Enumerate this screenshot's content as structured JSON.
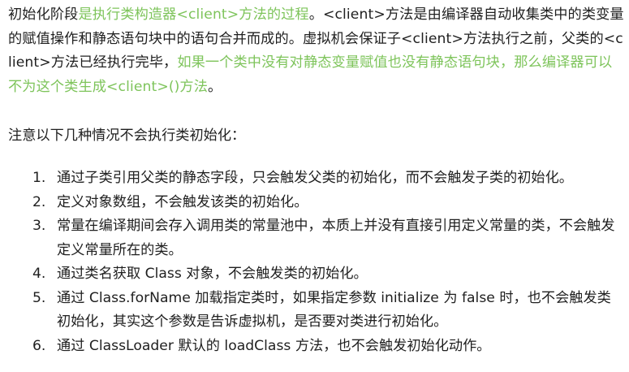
{
  "paragraph": {
    "p1": "初始化阶段",
    "p2_green": "是执行类构造器<client>方法的过程",
    "p3": "。<client>方法是由编译器自动收集类中的类变量的赋值操作和静态语句块中的语句合并而成的。虚拟机会保证子<client>方法执行之前，父类的<client>方法已经执行完毕，",
    "p4_green": "如果一个类中没有对静态变量赋值也没有静态语句块，那么编译器可以不为这个类生成<client>()方法",
    "p5": "。"
  },
  "note": "注意以下几种情况不会执行类初始化：",
  "items": [
    {
      "num": "1.",
      "text": "通过子类引用父类的静态字段，只会触发父类的初始化，而不会触发子类的初始化。"
    },
    {
      "num": "2.",
      "text": "定义对象数组，不会触发该类的初始化。"
    },
    {
      "num": "3.",
      "text": "常量在编译期间会存入调用类的常量池中，本质上并没有直接引用定义常量的类，不会触发定义常量所在的类。"
    },
    {
      "num": "4.",
      "text": "通过类名获取 Class 对象，不会触发类的初始化。"
    },
    {
      "num": "5.",
      "text": "通过 Class.forName 加载指定类时，如果指定参数 initialize 为 false 时，也不会触发类初始化，其实这个参数是告诉虚拟机，是否要对类进行初始化。"
    },
    {
      "num": "6.",
      "text": "通过 ClassLoader 默认的 loadClass 方法，也不会触发初始化动作。"
    }
  ],
  "colors": {
    "text": "#1f1f1f",
    "highlight_green": "#7ec45b"
  }
}
